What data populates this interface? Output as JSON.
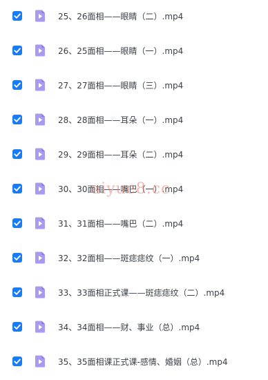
{
  "files": [
    {
      "name": "25、26面相——眼睛（二）.mp4",
      "checked": true,
      "icon": "video-file-icon"
    },
    {
      "name": "26、25面相——眼睛（一）.mp4",
      "checked": true,
      "icon": "video-file-icon"
    },
    {
      "name": "27、27面相——眼睛（三）.mp4",
      "checked": true,
      "icon": "video-file-icon"
    },
    {
      "name": "28、28面相——耳朵（一）.mp4",
      "checked": true,
      "icon": "video-file-icon"
    },
    {
      "name": "29、29面相——耳朵（二）.mp4",
      "checked": true,
      "icon": "video-file-icon"
    },
    {
      "name": "30、30面相——嘴巴（一）.mp4",
      "checked": true,
      "icon": "video-file-icon"
    },
    {
      "name": "31、31面相——嘴巴（二）.mp4",
      "checked": true,
      "icon": "video-file-icon"
    },
    {
      "name": "32、32面相——斑痣痣纹（一）.mp4",
      "checked": true,
      "icon": "video-file-icon"
    },
    {
      "name": "33、33面相正式课——斑痣痣纹（二）.mp4",
      "checked": true,
      "icon": "video-file-icon"
    },
    {
      "name": "34、34面相——财、事业（总）.mp4",
      "checked": true,
      "icon": "video-file-icon"
    },
    {
      "name": "35、35面相课正式课-感情、婚姻（总）.mp4",
      "checked": true,
      "icon": "video-file-icon"
    }
  ],
  "watermark": "aiyue8.cc",
  "colors": {
    "checkbox": "#1a7bf2",
    "icon_bg": "#a99af0",
    "icon_fold": "#8a78e8",
    "text": "#3a3f46"
  }
}
